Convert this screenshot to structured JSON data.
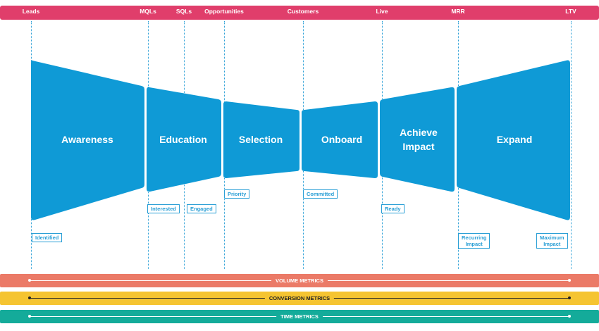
{
  "stages": [
    {
      "id": "leads",
      "label": "Leads"
    },
    {
      "id": "mqls",
      "label": "MQLs"
    },
    {
      "id": "sqls",
      "label": "SQLs"
    },
    {
      "id": "opportunities",
      "label": "Opportunities"
    },
    {
      "id": "customers",
      "label": "Customers"
    },
    {
      "id": "live",
      "label": "Live"
    },
    {
      "id": "mrr",
      "label": "MRR"
    },
    {
      "id": "ltv",
      "label": "LTV"
    }
  ],
  "segments": [
    {
      "id": "awareness",
      "label": "Awareness"
    },
    {
      "id": "education",
      "label": "Education"
    },
    {
      "id": "selection",
      "label": "Selection"
    },
    {
      "id": "onboard",
      "label": "Onboard"
    },
    {
      "id": "achieve-impact",
      "label": "Achieve\nImpact"
    },
    {
      "id": "expand",
      "label": "Expand"
    }
  ],
  "tags": [
    {
      "id": "identified",
      "label": "Identified"
    },
    {
      "id": "interested",
      "label": "Interested"
    },
    {
      "id": "engaged",
      "label": "Engaged"
    },
    {
      "id": "priority",
      "label": "Priority"
    },
    {
      "id": "committed",
      "label": "Committed"
    },
    {
      "id": "ready",
      "label": "Ready"
    },
    {
      "id": "recurring-impact",
      "label": "Recurring\nImpact"
    },
    {
      "id": "maximum-impact",
      "label": "Maximum\nImpact"
    }
  ],
  "metrics": [
    {
      "id": "volume",
      "label": "VOLUME METRICS"
    },
    {
      "id": "conversion",
      "label": "CONVERSION METRICS"
    },
    {
      "id": "time",
      "label": "TIME METRICS"
    }
  ],
  "colors": {
    "stage_bar": "#e03e6b",
    "funnel": "#0f9ad6",
    "volume": "#eb7a67",
    "conversion": "#f5c431",
    "time": "#14ab9a"
  }
}
